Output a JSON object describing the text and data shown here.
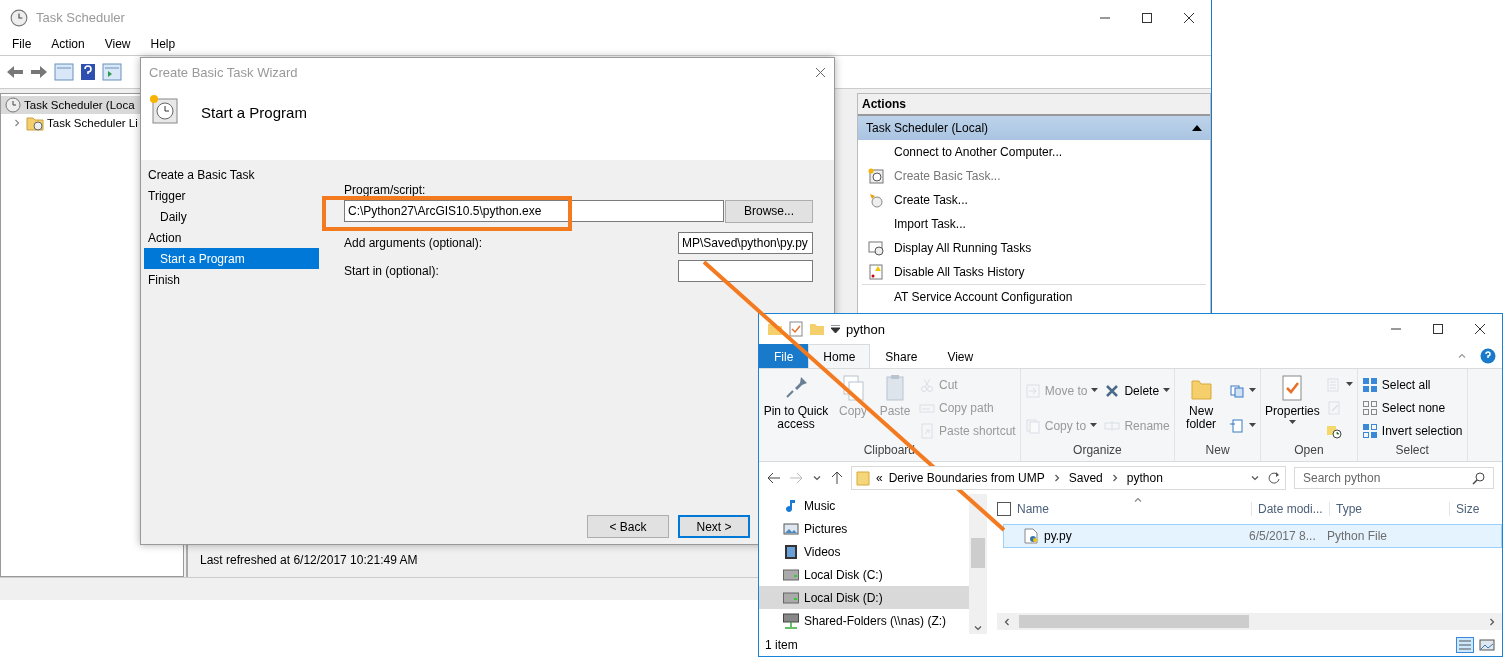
{
  "task_scheduler": {
    "title": "Task Scheduler",
    "menu": [
      "File",
      "Action",
      "View",
      "Help"
    ],
    "tree": [
      {
        "label": "Task Scheduler (Loca",
        "selected": true,
        "children": [
          {
            "label": "Task Scheduler Li",
            "selected": false,
            "expanded": false
          }
        ]
      }
    ],
    "status_text": "Last refreshed at 6/12/2017 10:21:49 AM",
    "actions": {
      "header": "Actions",
      "section": "Task Scheduler (Local)",
      "items": [
        {
          "label": "Connect to Another Computer...",
          "kind": "plain",
          "disabled": false
        },
        {
          "label": "Create Basic Task...",
          "kind": "wizard",
          "disabled": true
        },
        {
          "label": "Create Task...",
          "kind": "task",
          "disabled": false
        },
        {
          "label": "Import Task...",
          "kind": "plain",
          "disabled": false
        },
        {
          "label": "Display All Running Tasks",
          "kind": "running",
          "disabled": false
        },
        {
          "label": "Disable All Tasks History",
          "kind": "history",
          "disabled": false
        },
        {
          "label": "AT Service Account Configuration",
          "kind": "plain",
          "disabled": false
        }
      ]
    }
  },
  "wizard": {
    "title": "Create Basic Task Wizard",
    "heading": "Start a Program",
    "steps": [
      {
        "label": "Create a Basic Task",
        "selected": false
      },
      {
        "label": "Trigger",
        "selected": false,
        "children": [
          {
            "label": "Daily",
            "selected": false
          }
        ]
      },
      {
        "label": "Action",
        "selected": false,
        "children": [
          {
            "label": "Start a Program",
            "selected": true
          }
        ]
      },
      {
        "label": "Finish",
        "selected": false
      }
    ],
    "fields": [
      {
        "label": "Program/script:",
        "value": "C:\\Python27\\ArcGIS10.5\\python.exe",
        "kind": "wide",
        "button": "Browse..."
      },
      {
        "label": "Add arguments (optional):",
        "value": "MP\\Saved\\python\\py.py",
        "kind": "short"
      },
      {
        "label": "Start in (optional):",
        "kind": "short"
      }
    ],
    "buttons": [
      {
        "label": "< Back",
        "default": false
      },
      {
        "label": "Next >",
        "default": true
      }
    ]
  },
  "explorer": {
    "title": "python",
    "tabs": [
      {
        "label": "File",
        "kind": "file",
        "selected": false
      },
      {
        "label": "Home",
        "kind": "tab",
        "selected": true
      },
      {
        "label": "Share",
        "kind": "tab",
        "selected": false
      },
      {
        "label": "View",
        "kind": "tab",
        "selected": false
      }
    ],
    "ribbon": [
      {
        "label": "Clipboard",
        "columns": [
          [
            {
              "label": "Pin to Quick access",
              "kind": "pin",
              "disabled": false
            }
          ],
          [
            {
              "label": "Copy",
              "kind": "copy",
              "disabled": true
            }
          ],
          [
            {
              "label": "Paste",
              "kind": "paste",
              "disabled": true
            }
          ],
          [
            {
              "label": "Cut",
              "kind": "cut",
              "disabled": true
            },
            {
              "label": "Copy path",
              "kind": "copypath",
              "disabled": true
            },
            {
              "label": "Paste shortcut",
              "kind": "shortcut",
              "disabled": true
            }
          ]
        ]
      },
      {
        "label": "Organize",
        "columns": [
          [
            {
              "label": "Move to",
              "kind": "move",
              "disabled": true,
              "menu": true
            },
            {
              "label": "Copy to",
              "kind": "copyto",
              "disabled": true,
              "menu": true
            }
          ],
          [
            {
              "label": "Delete",
              "kind": "delete",
              "disabled": false,
              "menu": true
            },
            {
              "label": "Rename",
              "kind": "rename",
              "disabled": true
            }
          ]
        ]
      },
      {
        "label": "New",
        "columns": [
          [
            {
              "label": "New folder",
              "kind": "newfolder",
              "disabled": false
            }
          ],
          [
            {
              "kind": "newitem",
              "disabled": false,
              "menu": true
            },
            {
              "kind": "easyaccess",
              "disabled": false,
              "menu": true
            }
          ]
        ]
      },
      {
        "label": "Open",
        "columns": [
          [
            {
              "label": "Properties",
              "kind": "properties",
              "disabled": false,
              "menu": true
            }
          ],
          [
            {
              "kind": "openwith",
              "disabled": true,
              "menu": true
            },
            {
              "kind": "edit",
              "disabled": true
            },
            {
              "kind": "history",
              "disabled": false
            }
          ]
        ]
      },
      {
        "label": "Select",
        "columns": [
          [
            {
              "label": "Select all",
              "kind": "selectall",
              "disabled": false
            },
            {
              "label": "Select none",
              "kind": "selectnone",
              "disabled": false
            },
            {
              "label": "Invert selection",
              "kind": "invert",
              "disabled": false
            }
          ]
        ]
      }
    ],
    "address": {
      "overflow": "«",
      "crumbs": [
        "Derive Boundaries from UMP",
        "Saved",
        "python"
      ]
    },
    "search": {
      "placeholder": "Search python"
    },
    "nav": [
      {
        "label": "Music",
        "kind": "music",
        "selected": false
      },
      {
        "label": "Pictures",
        "kind": "pictures",
        "selected": false
      },
      {
        "label": "Videos",
        "kind": "videos",
        "selected": false
      },
      {
        "label": "Local Disk (C:)",
        "kind": "disk",
        "selected": false
      },
      {
        "label": "Local Disk (D:)",
        "kind": "disk",
        "selected": true
      },
      {
        "label": "Shared-Folders (\\\\nas) (Z:)",
        "kind": "network",
        "selected": false
      }
    ],
    "select_all": {
      "checked": false
    },
    "columns": [
      "Name",
      "Date modi...",
      "Type",
      "Size"
    ],
    "rows": [
      {
        "name": "py.py",
        "date": "6/5/2017 8...",
        "type": "Python File",
        "hovered": true
      }
    ],
    "status": "1 item"
  }
}
